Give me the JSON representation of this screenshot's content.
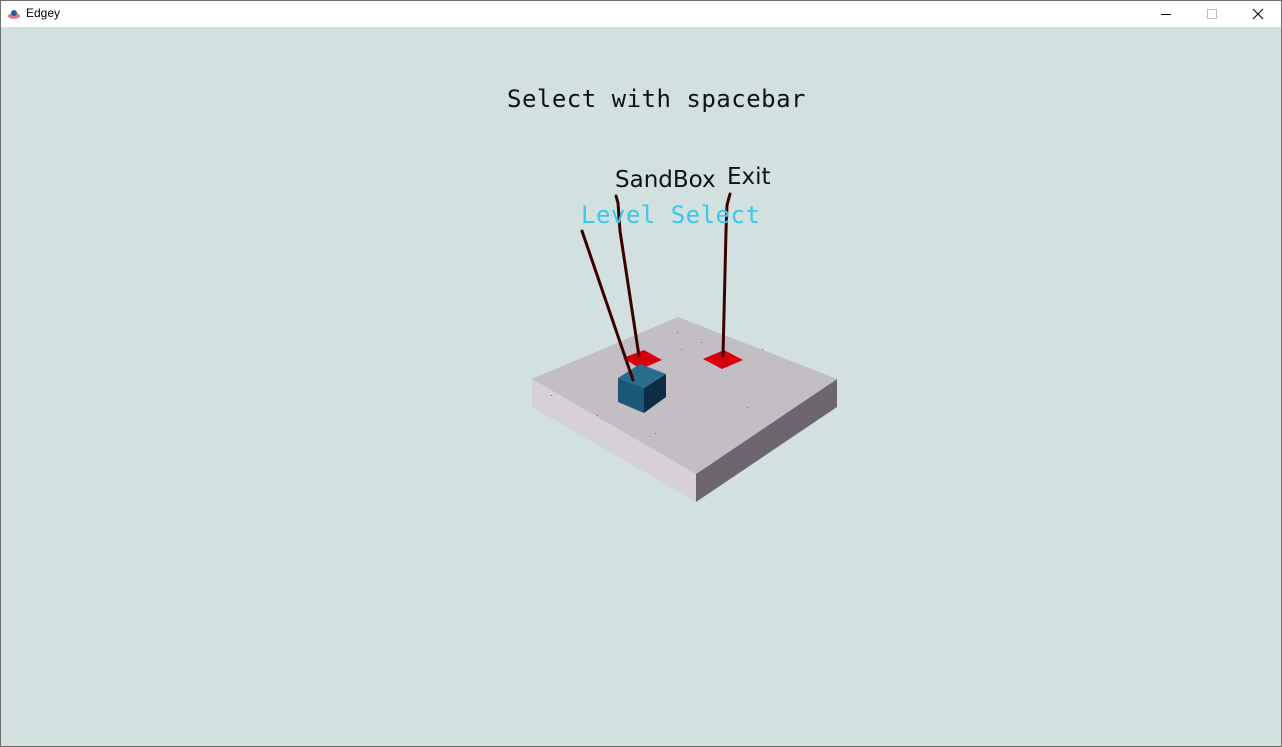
{
  "window": {
    "title": "Edgey",
    "icon": "edgey-app-icon",
    "controls": [
      "minimize-icon",
      "maximize-icon",
      "close-icon"
    ]
  },
  "hud": {
    "prompt": "Select with spacebar"
  },
  "menu_labels": {
    "sandbox": "SandBox",
    "exit": "Exit",
    "level_select": "Level Select"
  },
  "colors": {
    "background": "#d2e0e0",
    "platform_top": "#c3bec3",
    "selected_label": "#3cc7e8",
    "tile": "#d8000d",
    "player_cube": "#1b5878",
    "pointer_line": "#3a0000"
  }
}
